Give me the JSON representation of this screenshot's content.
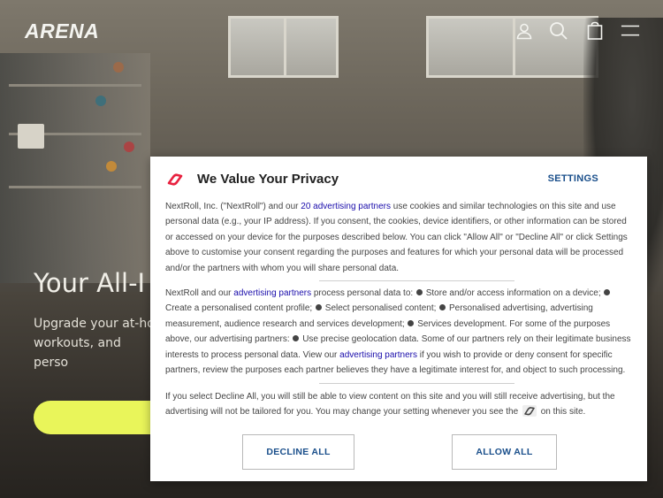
{
  "header": {
    "logo": "ARENA",
    "icons": [
      "account-icon",
      "search-icon",
      "cart-icon",
      "menu-icon"
    ]
  },
  "hero": {
    "title": "Your All-I",
    "subtitle": "Upgrade your at-ho workouts, and perso",
    "cta_color": "#e9f55a"
  },
  "privacy": {
    "title": "We Value Your Privacy",
    "settings_label": "SETTINGS",
    "p1": {
      "before": "NextRoll, Inc. (\"NextRoll\") and our ",
      "link": "20 advertising partners",
      "after": " use cookies and similar technologies on this site and use personal data (e.g., your IP address). If you consent, the cookies, device identifiers, or other information can be stored or accessed on your device for the purposes described below. You can click \"Allow All\" or \"Decline All\" or click Settings above to customise your consent regarding the purposes and features for which your personal data will be processed and/or the partners with whom you will share personal data."
    },
    "p2": {
      "t0": "NextRoll and our ",
      "link1": "advertising partners",
      "t1": " process personal data to: ",
      "i1": "Store and/or access information on a device; ",
      "i2": "Create a personalised content profile; ",
      "i3": "Select personalised content; ",
      "i4": "Personalised advertising, advertising measurement, audience research and services development; ",
      "i5": "Services development. For some of the purposes above, our advertising partners: ",
      "i6": "Use precise geolocation data. Some of our partners rely on their legitimate business interests to process personal data. View our ",
      "link2": "advertising partners",
      "t2": " if you wish to provide or deny consent for specific partners, review the purposes each partner believes they have a legitimate interest for, and object to such processing."
    },
    "p3": {
      "before": "If you select Decline All, you will still be able to view content on this site and you will still receive advertising, but the advertising will not be tailored for you. You may change your setting whenever you see the ",
      "after": " on this site."
    },
    "decline_label": "DECLINE ALL",
    "allow_label": "ALLOW ALL",
    "brand_color": "#e8213f",
    "link_color": "#1a0dab"
  }
}
